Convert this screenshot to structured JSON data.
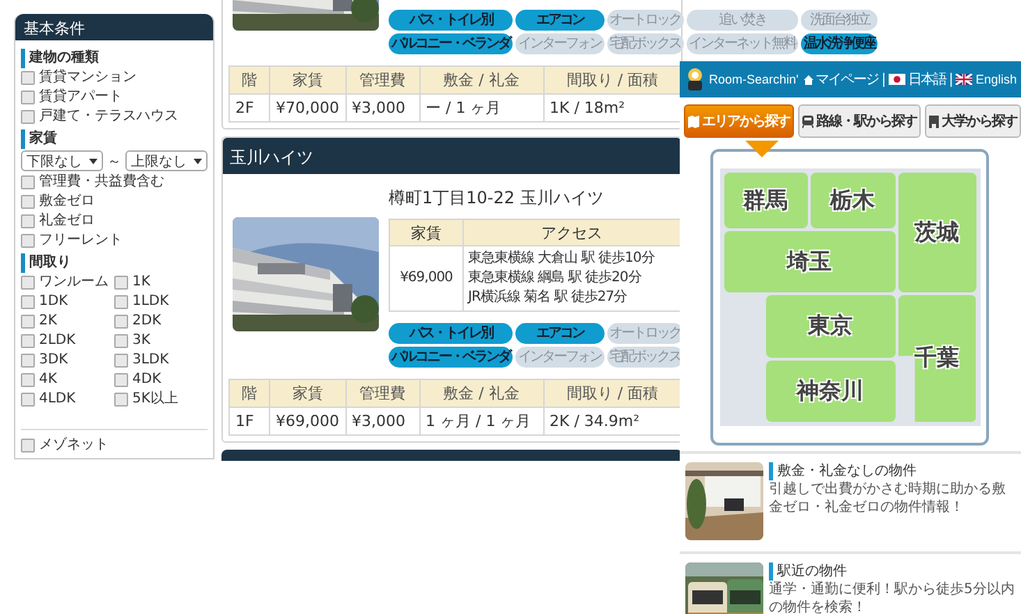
{
  "sidebar": {
    "title": "基本条件",
    "sections": [
      {
        "heading": "建物の種類",
        "kind": "list",
        "options": [
          {
            "label": "賃貸マンション",
            "checked": false
          },
          {
            "label": "賃貸アパート",
            "checked": false
          },
          {
            "label": "戸建て・テラスハウス",
            "checked": false
          }
        ]
      },
      {
        "heading": "家賃",
        "kind": "rent",
        "range": {
          "min": "下限なし",
          "separator": "～",
          "max": "上限なし"
        },
        "options": [
          {
            "label": "管理費・共益費含む",
            "checked": false
          },
          {
            "label": "敷金ゼロ",
            "checked": false
          },
          {
            "label": "礼金ゼロ",
            "checked": false
          },
          {
            "label": "フリーレント",
            "checked": false
          }
        ]
      },
      {
        "heading": "間取り",
        "kind": "grid",
        "options": [
          {
            "label": "ワンルーム",
            "checked": false
          },
          {
            "label": "1K",
            "checked": false
          },
          {
            "label": "1DK",
            "checked": false
          },
          {
            "label": "1LDK",
            "checked": false
          },
          {
            "label": "2K",
            "checked": false
          },
          {
            "label": "2DK",
            "checked": false
          },
          {
            "label": "2LDK",
            "checked": false
          },
          {
            "label": "3K",
            "checked": false
          },
          {
            "label": "3DK",
            "checked": false
          },
          {
            "label": "3LDK",
            "checked": false
          },
          {
            "label": "4K",
            "checked": false
          },
          {
            "label": "4DK",
            "checked": false
          },
          {
            "label": "4LDK",
            "checked": false
          },
          {
            "label": "5K以上",
            "checked": false
          }
        ],
        "extra_options": [
          {
            "label": "メゾネット",
            "checked": false
          }
        ]
      }
    ]
  },
  "listings": [
    {
      "tag_rows": [
        [
          {
            "label": "バス・トイレ別",
            "on": true
          },
          {
            "label": "エアコン",
            "on": true
          },
          {
            "label": "オートロック",
            "on": false
          },
          {
            "label": "追い焚き",
            "on": false
          },
          {
            "label": "洗面台独立",
            "on": false
          }
        ],
        [
          {
            "label": "バルコニー・ベランダ",
            "on": true
          },
          {
            "label": "インターフォン",
            "on": false
          },
          {
            "label": "宅配ボックス",
            "on": false
          },
          {
            "label": "インターネット無料",
            "on": false
          },
          {
            "label": "温水洗浄便座",
            "on": true
          }
        ]
      ],
      "table": {
        "columns": [
          "階",
          "家賃",
          "管理費",
          "敷金 / 礼金",
          "間取り / 面積"
        ],
        "rows": [
          [
            "2F",
            "¥70,000",
            "¥3,000",
            "ー / 1 ヶ月",
            "1K / 18m²"
          ]
        ]
      }
    },
    {
      "title": "玉川ハイツ",
      "address": "樽町1丁目10-22 玉川ハイツ",
      "summary": {
        "columns": [
          "家賃",
          "アクセス"
        ],
        "rent": "¥69,000",
        "access": [
          "東急東横線 大倉山 駅 徒歩10分",
          "東急東横線 綱島 駅 徒歩20分",
          "JR横浜線 菊名 駅 徒歩27分"
        ]
      },
      "tag_rows": [
        [
          {
            "label": "バス・トイレ別",
            "on": true
          },
          {
            "label": "エアコン",
            "on": true
          },
          {
            "label": "オートロック",
            "on": false
          }
        ],
        [
          {
            "label": "バルコニー・ベランダ",
            "on": true
          },
          {
            "label": "インターフォン",
            "on": false
          },
          {
            "label": "宅配ボックス",
            "on": false
          }
        ]
      ],
      "table": {
        "columns": [
          "階",
          "家賃",
          "管理費",
          "敷金 / 礼金",
          "間取り / 面積"
        ],
        "rows": [
          [
            "1F",
            "¥69,000",
            "¥3,000",
            "1 ヶ月 / 1 ヶ月",
            "2K / 34.9m²"
          ]
        ]
      }
    }
  ],
  "widget": {
    "brand": "Room-Searchin'",
    "links": [
      {
        "label": "マイページ",
        "kind": "home"
      },
      {
        "label": "日本語",
        "kind": "ja"
      },
      {
        "label": "English",
        "kind": "en"
      }
    ],
    "separators": [
      "|",
      "|"
    ],
    "tabs": [
      {
        "label": "エリアから探す",
        "kind": "map",
        "selected": true
      },
      {
        "label": "路線・駅から探す",
        "kind": "train",
        "selected": false
      },
      {
        "label": "大学から探す",
        "kind": "school",
        "selected": false
      }
    ],
    "regions": [
      "群馬",
      "栃木",
      "茨城",
      "埼玉",
      "東京",
      "千葉",
      "神奈川"
    ],
    "features": [
      {
        "title": "敷金・礼金なしの物件",
        "text": "引越しで出費がかさむ時期に助かる敷金ゼロ・礼金ゼロの物件情報！",
        "kind": "room"
      },
      {
        "title": "駅近の物件",
        "text": "通学・通勤に便利！駅から徒歩5分以内の物件を検索！",
        "kind": "train"
      }
    ]
  }
}
